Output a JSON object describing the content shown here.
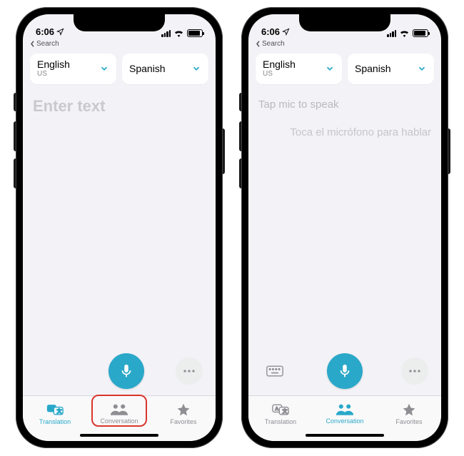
{
  "status": {
    "time": "6:06",
    "back_label": "Search"
  },
  "languages": {
    "source": {
      "name": "English",
      "sub": "US"
    },
    "target": {
      "name": "Spanish"
    }
  },
  "left_screen": {
    "placeholder": "Enter text"
  },
  "right_screen": {
    "prompt_source": "Tap mic to speak",
    "prompt_target": "Toca el micrófono para hablar"
  },
  "tabs": {
    "translation": "Translation",
    "conversation": "Conversation",
    "favorites": "Favorites"
  },
  "colors": {
    "accent": "#2aa8c9",
    "highlight": "#d9362b"
  }
}
